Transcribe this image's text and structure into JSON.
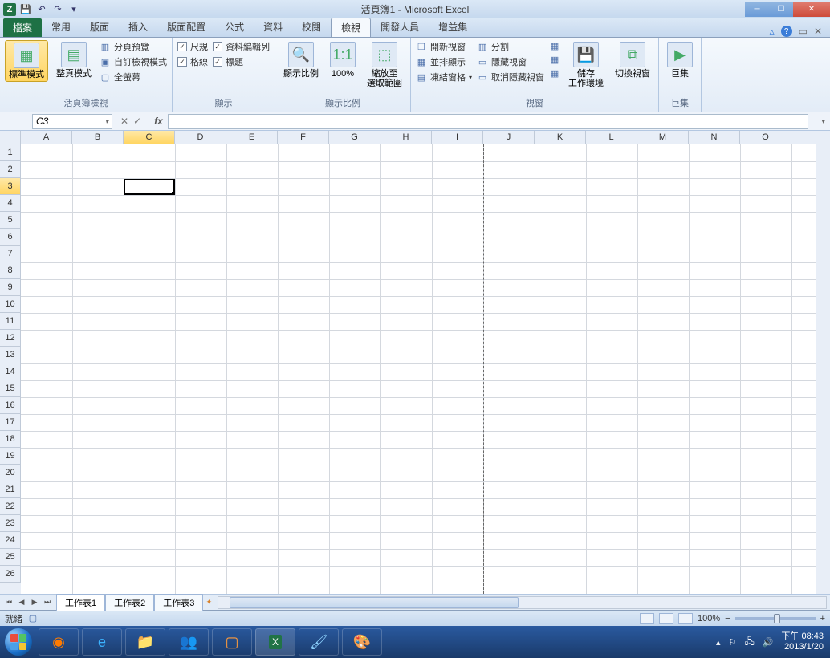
{
  "title": "活頁簿1 - Microsoft Excel",
  "tabs": {
    "file": "檔案",
    "items": [
      "常用",
      "版面",
      "插入",
      "版面配置",
      "公式",
      "資料",
      "校閱",
      "檢視",
      "開發人員",
      "增益集"
    ],
    "active_index": 7
  },
  "ribbon": {
    "group1": {
      "label": "活頁簿檢視",
      "big1": "標準模式",
      "big2": "整頁模式",
      "i1": "分頁預覽",
      "i2": "自訂檢視模式",
      "i3": "全螢幕"
    },
    "group2": {
      "label": "顯示",
      "i1": "尺規",
      "i2": "資料編輯列",
      "i3": "格線",
      "i4": "標題"
    },
    "group3": {
      "label": "顯示比例",
      "b1": "顯示比例",
      "b2": "100%",
      "b3": "縮放至\n選取範圍"
    },
    "group4": {
      "label": "視窗",
      "i1": "開新視窗",
      "i2": "分割",
      "i3": "並排顯示",
      "i4": "隱藏視窗",
      "i5": "凍結窗格",
      "i6": "取消隱藏視窗",
      "b1": "儲存\n工作環境",
      "b2": "切換視窗"
    },
    "group5": {
      "label": "巨集",
      "b1": "巨集"
    }
  },
  "namebox": "C3",
  "columns": [
    "A",
    "B",
    "C",
    "D",
    "E",
    "F",
    "G",
    "H",
    "I",
    "J",
    "K",
    "L",
    "M",
    "N",
    "O"
  ],
  "rows_count": 26,
  "selected_col": "C",
  "selected_row": 3,
  "sheets": [
    "工作表1",
    "工作表2",
    "工作表3"
  ],
  "status": {
    "left": "就緒",
    "zoom": "100%"
  },
  "taskbar": {
    "time": "下午 08:43",
    "date": "2013/1/20"
  }
}
